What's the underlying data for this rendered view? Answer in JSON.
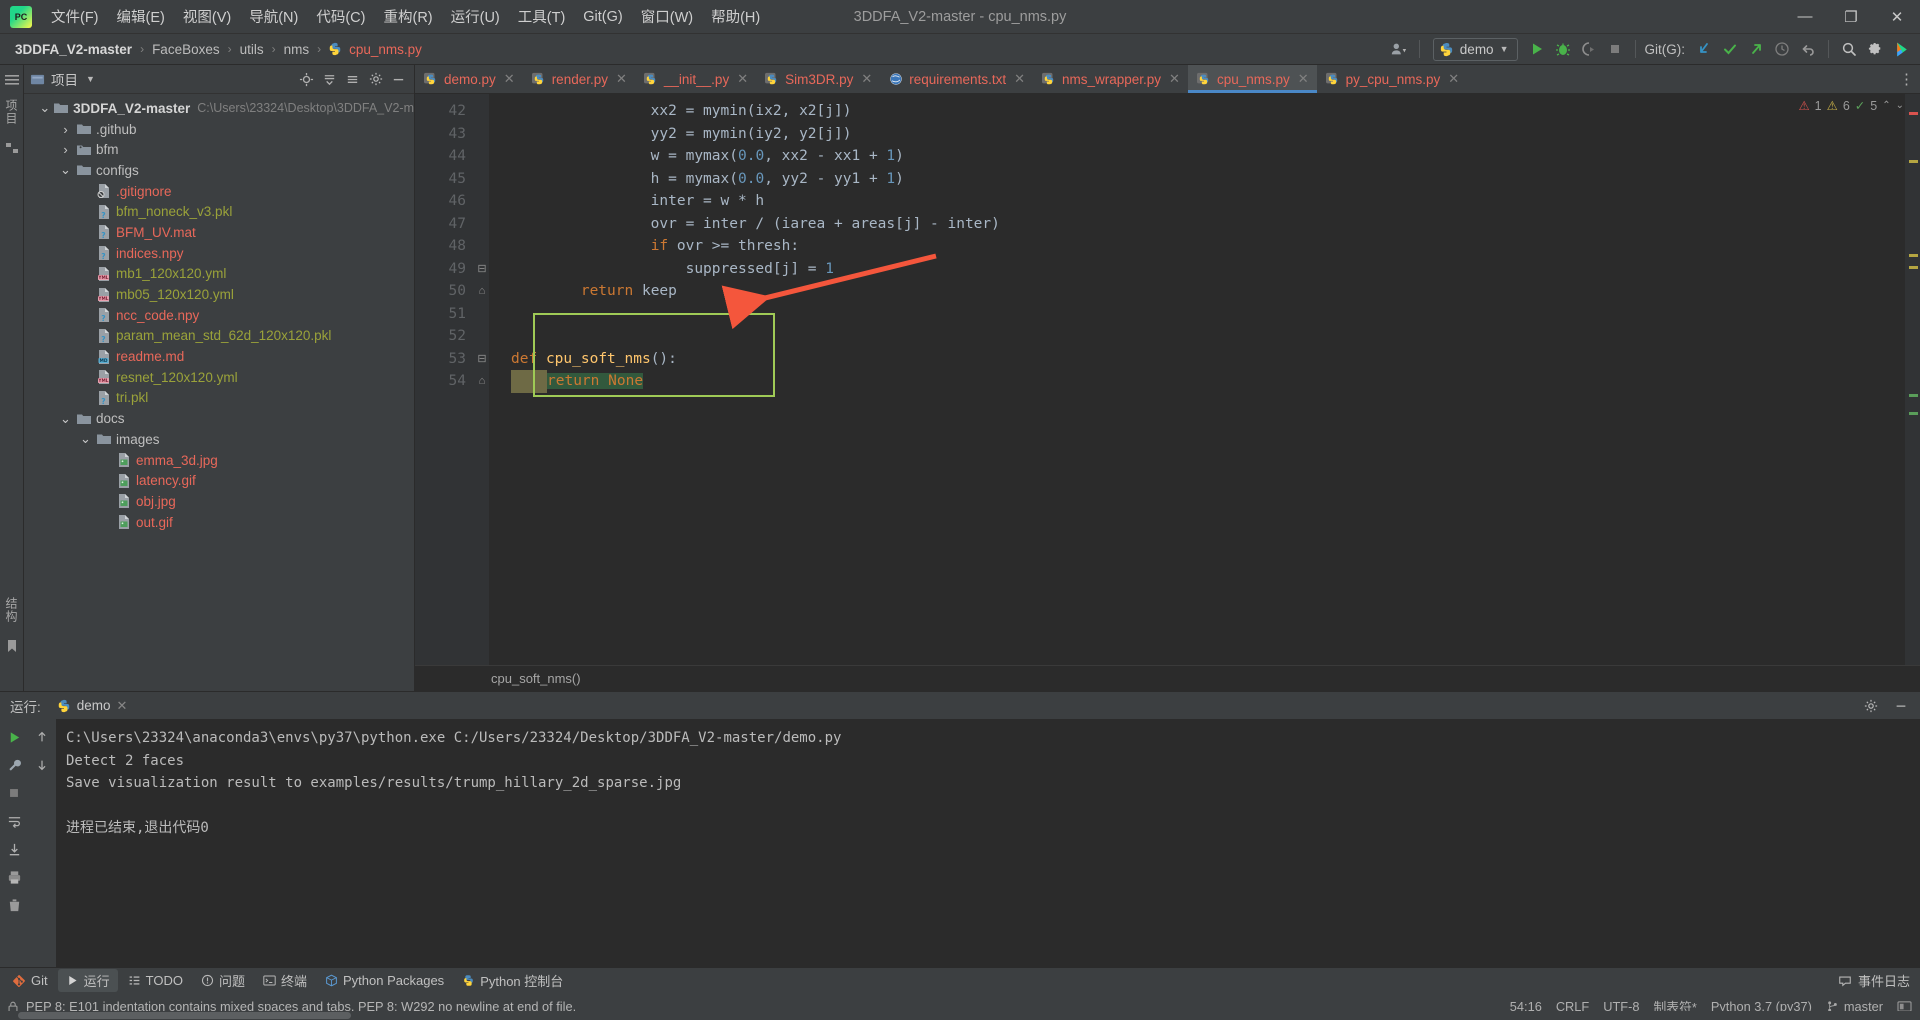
{
  "window": {
    "title": "3DDFA_V2-master - cpu_nms.py",
    "logo_text": "PC",
    "minimize": "—",
    "maximize": "❐",
    "close": "✕"
  },
  "menu": [
    {
      "label": "文件(F)",
      "name": "menu-file"
    },
    {
      "label": "编辑(E)",
      "name": "menu-edit"
    },
    {
      "label": "视图(V)",
      "name": "menu-view"
    },
    {
      "label": "导航(N)",
      "name": "menu-navigate"
    },
    {
      "label": "代码(C)",
      "name": "menu-code"
    },
    {
      "label": "重构(R)",
      "name": "menu-refactor"
    },
    {
      "label": "运行(U)",
      "name": "menu-run"
    },
    {
      "label": "工具(T)",
      "name": "menu-tools"
    },
    {
      "label": "Git(G)",
      "name": "menu-git"
    },
    {
      "label": "窗口(W)",
      "name": "menu-window"
    },
    {
      "label": "帮助(H)",
      "name": "menu-help"
    }
  ],
  "breadcrumb": {
    "items": [
      "3DDFA_V2-master",
      "FaceBoxes",
      "utils",
      "nms"
    ],
    "file": "cpu_nms.py",
    "separator": "›"
  },
  "toolbar": {
    "run_config": "demo",
    "git_label": "Git(G):",
    "icons": [
      "people-icon",
      "run-icon",
      "debug-icon",
      "coverage-icon",
      "stop-icon",
      "git-update-icon",
      "git-commit-icon",
      "git-push-icon",
      "history-icon",
      "rollback-icon",
      "search-everywhere-icon",
      "settings-icon",
      "ide-helper-icon"
    ]
  },
  "project": {
    "title": "项目",
    "tools": [
      "locate-icon",
      "expand-all-icon",
      "collapse-all-icon",
      "settings-icon",
      "hide-icon"
    ],
    "tree": [
      {
        "label": "3DDFA_V2-master",
        "path": "C:\\Users\\23324\\Desktop\\3DDFA_V2-m",
        "indent": 0,
        "twisty": "⌄",
        "icon": "folder-icon",
        "kind": "root"
      },
      {
        "label": ".github",
        "indent": 1,
        "twisty": "›",
        "icon": "folder-icon",
        "kind": "folder"
      },
      {
        "label": "bfm",
        "indent": 1,
        "twisty": "›",
        "icon": "folder-module-icon",
        "kind": "folder"
      },
      {
        "label": "configs",
        "indent": 1,
        "twisty": "⌄",
        "icon": "folder-icon",
        "kind": "folder"
      },
      {
        "label": ".gitignore",
        "indent": 2,
        "twisty": "",
        "icon": "file-ignored-icon",
        "kind": "file",
        "color": "#e8685a"
      },
      {
        "label": "bfm_noneck_v3.pkl",
        "indent": 2,
        "twisty": "",
        "icon": "file-unknown-icon",
        "kind": "file",
        "color": "#9aa23a"
      },
      {
        "label": "BFM_UV.mat",
        "indent": 2,
        "twisty": "",
        "icon": "file-unknown-icon",
        "kind": "file",
        "color": "#e8685a"
      },
      {
        "label": "indices.npy",
        "indent": 2,
        "twisty": "",
        "icon": "file-unknown-icon",
        "kind": "file",
        "color": "#e8685a"
      },
      {
        "label": "mb1_120x120.yml",
        "indent": 2,
        "twisty": "",
        "icon": "file-yml-icon",
        "kind": "file",
        "color": "#9aa23a"
      },
      {
        "label": "mb05_120x120.yml",
        "indent": 2,
        "twisty": "",
        "icon": "file-yml-icon",
        "kind": "file",
        "color": "#9aa23a"
      },
      {
        "label": "ncc_code.npy",
        "indent": 2,
        "twisty": "",
        "icon": "file-unknown-icon",
        "kind": "file",
        "color": "#e8685a"
      },
      {
        "label": "param_mean_std_62d_120x120.pkl",
        "indent": 2,
        "twisty": "",
        "icon": "file-unknown-icon",
        "kind": "file",
        "color": "#9aa23a"
      },
      {
        "label": "readme.md",
        "indent": 2,
        "twisty": "",
        "icon": "file-md-icon",
        "kind": "file",
        "color": "#e8685a"
      },
      {
        "label": "resnet_120x120.yml",
        "indent": 2,
        "twisty": "",
        "icon": "file-yml-icon",
        "kind": "file",
        "color": "#9aa23a"
      },
      {
        "label": "tri.pkl",
        "indent": 2,
        "twisty": "",
        "icon": "file-unknown-icon",
        "kind": "file",
        "color": "#9aa23a"
      },
      {
        "label": "docs",
        "indent": 1,
        "twisty": "⌄",
        "icon": "folder-icon",
        "kind": "folder"
      },
      {
        "label": "images",
        "indent": 2,
        "twisty": "⌄",
        "icon": "folder-icon",
        "kind": "folder"
      },
      {
        "label": "emma_3d.jpg",
        "indent": 3,
        "twisty": "",
        "icon": "file-image-icon",
        "kind": "file",
        "color": "#e8685a"
      },
      {
        "label": "latency.gif",
        "indent": 3,
        "twisty": "",
        "icon": "file-image-icon",
        "kind": "file",
        "color": "#e8685a"
      },
      {
        "label": "obj.jpg",
        "indent": 3,
        "twisty": "",
        "icon": "file-image-icon",
        "kind": "file",
        "color": "#e8685a"
      },
      {
        "label": "out.gif",
        "indent": 3,
        "twisty": "",
        "icon": "file-image-icon",
        "kind": "file",
        "color": "#e8685a"
      }
    ]
  },
  "editor": {
    "tabs": [
      {
        "label": "demo.py",
        "icon": "python-file-icon",
        "active": false
      },
      {
        "label": "render.py",
        "icon": "python-file-icon",
        "active": false
      },
      {
        "label": "__init__.py",
        "icon": "python-file-icon",
        "active": false
      },
      {
        "label": "Sim3DR.py",
        "icon": "python-file-icon",
        "active": false
      },
      {
        "label": "requirements.txt",
        "icon": "text-file-icon",
        "active": false
      },
      {
        "label": "nms_wrapper.py",
        "icon": "python-file-icon",
        "active": false
      },
      {
        "label": "cpu_nms.py",
        "icon": "python-file-icon",
        "active": true
      },
      {
        "label": "py_cpu_nms.py",
        "icon": "python-file-icon",
        "active": false
      }
    ],
    "close_glyph": "✕",
    "line_numbers": [
      "42",
      "43",
      "44",
      "45",
      "46",
      "47",
      "48",
      "49",
      "50",
      "51",
      "52",
      "53",
      "54"
    ],
    "lines": [
      {
        "n": "42",
        "tokens": [
          {
            "t": "                xx2 = mymin(ix2, x2[j])",
            "c": "p"
          }
        ]
      },
      {
        "n": "43",
        "tokens": [
          {
            "t": "                yy2 = mymin(iy2, y2[j])",
            "c": "p"
          }
        ]
      },
      {
        "n": "44",
        "tokens": [
          {
            "t": "                w = mymax(",
            "c": "p"
          },
          {
            "t": "0.0",
            "c": "n"
          },
          {
            "t": ", xx2 - xx1 + ",
            "c": "p"
          },
          {
            "t": "1",
            "c": "n"
          },
          {
            "t": ")",
            "c": "p"
          }
        ]
      },
      {
        "n": "45",
        "tokens": [
          {
            "t": "                h = mymax(",
            "c": "p"
          },
          {
            "t": "0.0",
            "c": "n"
          },
          {
            "t": ", yy2 - yy1 + ",
            "c": "p"
          },
          {
            "t": "1",
            "c": "n"
          },
          {
            "t": ")",
            "c": "p"
          }
        ]
      },
      {
        "n": "46",
        "tokens": [
          {
            "t": "                inter = w * h",
            "c": "p"
          }
        ]
      },
      {
        "n": "47",
        "tokens": [
          {
            "t": "                ovr = inter / (iarea + areas[j] - inter)",
            "c": "p"
          }
        ]
      },
      {
        "n": "48",
        "tokens": [
          {
            "t": "                ",
            "c": "p"
          },
          {
            "t": "if",
            "c": "k"
          },
          {
            "t": " ovr >= thresh:",
            "c": "p"
          }
        ]
      },
      {
        "n": "49",
        "tokens": [
          {
            "t": "                    suppressed[j] = ",
            "c": "p"
          },
          {
            "t": "1",
            "c": "n"
          }
        ]
      },
      {
        "n": "50",
        "tokens": [
          {
            "t": "        ",
            "c": "p"
          },
          {
            "t": "return",
            "c": "k"
          },
          {
            "t": " keep",
            "c": "p"
          }
        ]
      },
      {
        "n": "51",
        "tokens": []
      },
      {
        "n": "52",
        "tokens": []
      },
      {
        "n": "53",
        "tokens": [
          {
            "t": "def",
            "c": "k"
          },
          {
            "t": " ",
            "c": "p"
          },
          {
            "t": "cpu_soft_nms",
            "c": "f"
          },
          {
            "t": "():",
            "c": "p"
          }
        ]
      },
      {
        "n": "54",
        "tokens": [
          {
            "t": "return None",
            "c": "hl"
          }
        ]
      }
    ],
    "bottom_breadcrumb": "cpu_soft_nms()",
    "warnings": {
      "errors": "1",
      "warnings": "6",
      "typos": "5"
    }
  },
  "run": {
    "label": "运行:",
    "tab": "demo",
    "close_glyph": "✕",
    "side_icons": [
      "rerun-icon",
      "wrench-icon",
      "stop-icon",
      "soft-wrap-icon",
      "scroll-end-icon",
      "print-icon",
      "clear-all-icon"
    ],
    "nav_icons": [
      "up-icon",
      "down-icon"
    ],
    "console": [
      "C:\\Users\\23324\\anaconda3\\envs\\py37\\python.exe C:/Users/23324/Desktop/3DDFA_V2-master/demo.py",
      "Detect 2 faces",
      "Save visualization result to examples/results/trump_hillary_2d_sparse.jpg",
      "",
      "进程已结束,退出代码0"
    ],
    "settings_icon": "gear-icon",
    "hide_icon": "hide-icon"
  },
  "left_stripe": {
    "vertical_labels": [
      "项目",
      "结构",
      "Bookmarks"
    ]
  },
  "bottom_bar": {
    "items": [
      {
        "label": "Git",
        "icon": "git-icon",
        "active": false
      },
      {
        "label": "运行",
        "icon": "run-icon",
        "active": true
      },
      {
        "label": "TODO",
        "icon": "todo-icon",
        "active": false
      },
      {
        "label": "问题",
        "icon": "problems-icon",
        "active": false
      },
      {
        "label": "终端",
        "icon": "terminal-icon",
        "active": false
      },
      {
        "label": "Python Packages",
        "icon": "packages-icon",
        "active": false
      },
      {
        "label": "Python 控制台",
        "icon": "python-console-icon",
        "active": false
      }
    ],
    "event_log": "事件日志",
    "event_log_icon": "balloon-icon"
  },
  "statusbar": {
    "message": "PEP 8: E101 indentation contains mixed spaces and tabs. PEP 8: W292 no newline at end of file.",
    "caret": "54:16",
    "line_sep": "CRLF",
    "encoding": "UTF-8",
    "indent": "制表符*",
    "interpreter": "Python 3.7 (py37)",
    "branch": "master",
    "lock_icon": "lock-icon",
    "branch_icon": "branch-icon",
    "memory_icon": "memory-icon"
  },
  "colors": {
    "accent_blue": "#4a88c7",
    "highlight_green": "#9fca56",
    "arrow_red": "#f4563c",
    "file_red": "#e8685a",
    "keyword_orange": "#cc7832",
    "number_blue": "#6897bb",
    "func_yellow": "#ffc66d"
  }
}
